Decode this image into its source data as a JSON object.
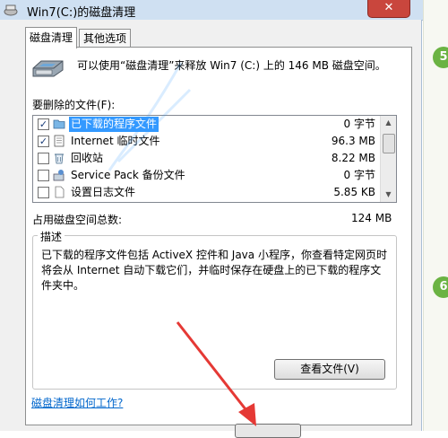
{
  "window": {
    "title": "Win7(C:)的磁盘清理",
    "close_glyph": "✕"
  },
  "tabs": [
    {
      "label": "磁盘清理",
      "active": true
    },
    {
      "label": "其他选项",
      "active": false
    }
  ],
  "intro_text": "可以使用“磁盘清理”来释放 Win7 (C:) 上的 146 MB 磁盘空间。",
  "files_label": "要删除的文件(F):",
  "files": [
    {
      "name": "已下载的程序文件",
      "size": "0 字节",
      "checked": true,
      "selected": true,
      "icon": "folder-icon"
    },
    {
      "name": "Internet 临时文件",
      "size": "96.3 MB",
      "checked": true,
      "selected": false,
      "icon": "document-icon"
    },
    {
      "name": "回收站",
      "size": "8.22 MB",
      "checked": false,
      "selected": false,
      "icon": "recycle-bin-icon"
    },
    {
      "name": "Service Pack 备份文件",
      "size": "0 字节",
      "checked": false,
      "selected": false,
      "icon": "backup-icon"
    },
    {
      "name": "设置日志文件",
      "size": "5.85 KB",
      "checked": false,
      "selected": false,
      "icon": "blank-file-icon"
    }
  ],
  "total": {
    "label": "占用磁盘空间总数:",
    "value": "124 MB"
  },
  "description": {
    "title": "描述",
    "text": "已下载的程序文件包括 ActiveX 控件和 Java 小程序，你查看特定网页时将会从 Internet 自动下载它们，并临时保存在硬盘上的已下载的程序文件夹中。"
  },
  "view_files_button": "查看文件(V)",
  "help_link": "磁盘清理如何工作?",
  "step_numbers": [
    "5",
    "6"
  ],
  "colors": {
    "selection": "#3399ff",
    "link": "#0066cc",
    "close": "#c9463d",
    "step_badge": "#6bb343",
    "annotation_arrow": "#e53935"
  }
}
